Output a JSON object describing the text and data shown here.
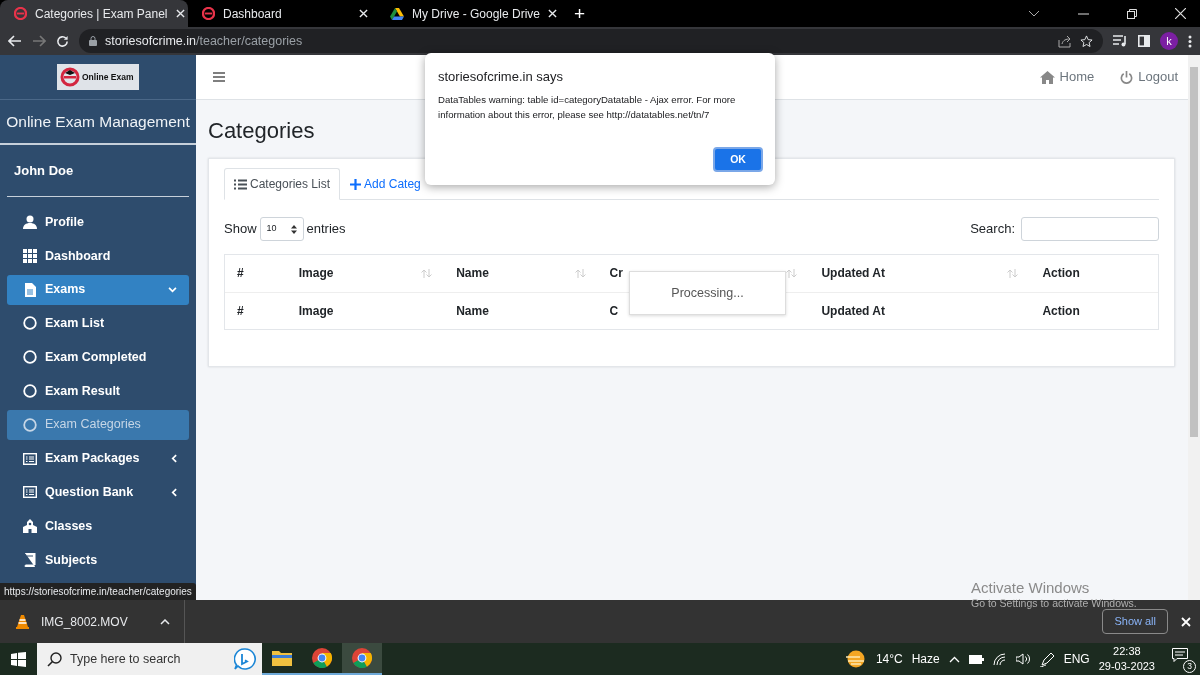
{
  "browser": {
    "tabs": [
      {
        "title": "Categories | Exam Panel",
        "selected": true
      },
      {
        "title": "Dashboard",
        "selected": false
      },
      {
        "title": "My Drive - Google Drive",
        "selected": false
      }
    ],
    "new_tab": "+",
    "forward_disabled": true,
    "address": {
      "host": "storiesofcrime.in",
      "path": "/teacher/categories"
    },
    "avatar": "k"
  },
  "sidebar": {
    "logo_text": "Online Exam",
    "brand": "Online Exam Management",
    "user": "John Doe",
    "items": [
      {
        "label": "Profile",
        "kind": "item",
        "selected": false
      },
      {
        "label": "Dashboard",
        "kind": "item",
        "selected": false
      },
      {
        "label": "Exams",
        "kind": "item",
        "selected": true,
        "expanded": true
      },
      {
        "label": "Exam List",
        "kind": "sub",
        "selected": false
      },
      {
        "label": "Exam Completed",
        "kind": "sub",
        "selected": false
      },
      {
        "label": "Exam Result",
        "kind": "sub",
        "selected": false
      },
      {
        "label": "Exam Categories",
        "kind": "sub",
        "selected": true
      },
      {
        "label": "Exam Packages",
        "kind": "item",
        "selected": false,
        "expanded": false
      },
      {
        "label": "Question Bank",
        "kind": "item",
        "selected": false,
        "expanded": false
      },
      {
        "label": "Classes",
        "kind": "item",
        "selected": false
      },
      {
        "label": "Subjects",
        "kind": "item",
        "selected": false
      }
    ]
  },
  "topbar": {
    "links": [
      {
        "label": "Home"
      },
      {
        "label": "Logout"
      }
    ]
  },
  "page_title": "Categories",
  "card": {
    "tabs": [
      {
        "label": "Categories List",
        "selected": true
      },
      {
        "label": "Add Categ",
        "selected": false
      }
    ],
    "length": {
      "before": "Show",
      "value": "10",
      "after": "entries"
    },
    "search_label": "Search:",
    "columns": [
      {
        "label": "#",
        "sortable": false
      },
      {
        "label": "Image",
        "sortable": true
      },
      {
        "label": "Name",
        "sortable": true
      },
      {
        "label": "Cr",
        "sortable": true
      },
      {
        "label": "Updated At",
        "sortable": true
      },
      {
        "label": "Action",
        "sortable": false
      }
    ],
    "footer_columns": [
      "#",
      "Image",
      "Name",
      "C",
      "Updated At",
      "Action"
    ],
    "processing": "Processing..."
  },
  "dialog": {
    "title": "storiesofcrime.in says",
    "message": "DataTables warning: table id=categoryDatatable - Ajax error. For more information about this error, please see http://datatables.net/tn/7",
    "button": "OK"
  },
  "status_url": "https://storiesofcrime.in/teacher/categories",
  "downloads": {
    "file": "IMG_8002.MOV",
    "show_all": "Show all"
  },
  "activation": {
    "title": "Activate Windows",
    "subtitle": "Go to Settings to activate Windows."
  },
  "taskbar": {
    "search_placeholder": "Type here to search",
    "temperature": "14°C",
    "condition": "Haze",
    "language": "ENG",
    "time": "22:38",
    "date": "29-03-2023",
    "notifications": "3"
  }
}
